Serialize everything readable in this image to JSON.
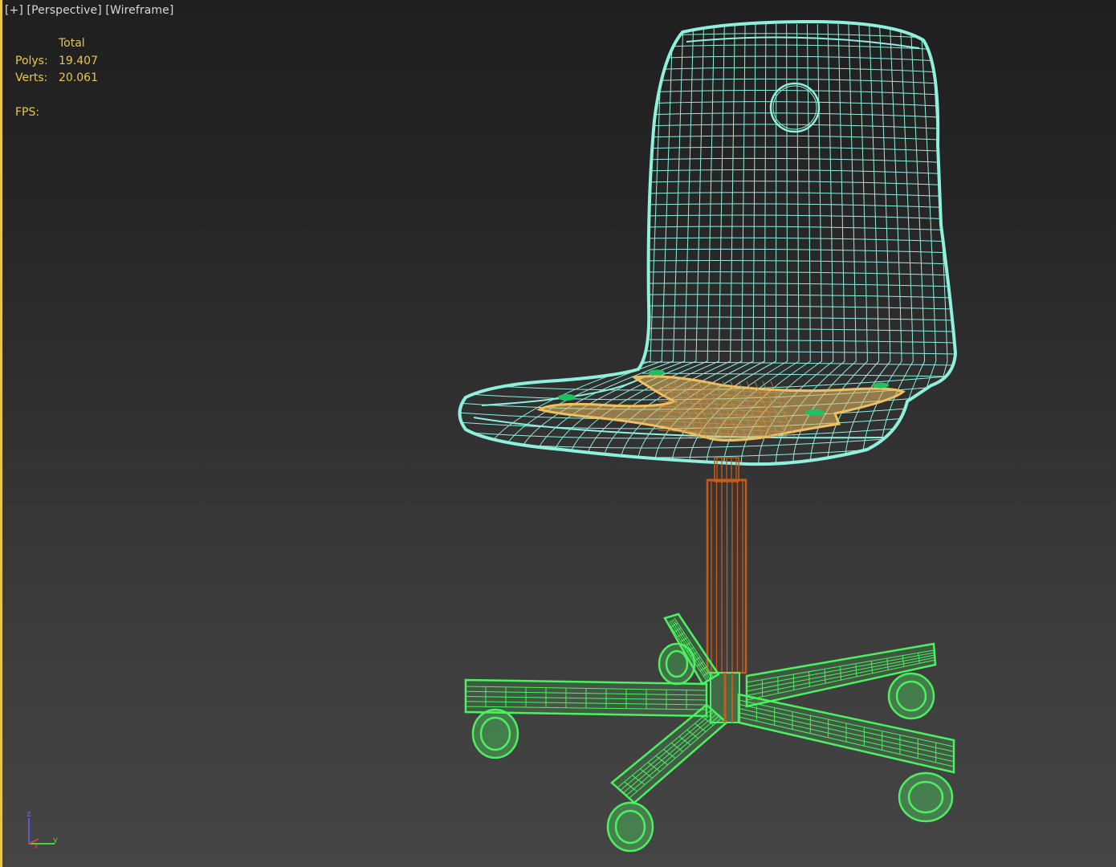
{
  "viewport": {
    "labels": {
      "menu": "[+]",
      "view": "[Perspective]",
      "shading": "[Wireframe]"
    },
    "stats": {
      "header": "Total",
      "polys_label": "Polys:",
      "polys_value": "19.407",
      "verts_label": "Verts:",
      "verts_value": "20.061",
      "fps_label": "FPS:"
    },
    "axis": {
      "z": "z",
      "x": "x",
      "y": "y"
    },
    "colors": {
      "shell": "#8ff0dc",
      "plate": "#f0c060",
      "column": "#c85a1a",
      "base": "#4cf060",
      "stats": "#e8c84a"
    },
    "objects": [
      {
        "name": "seat-shell-wireframe"
      },
      {
        "name": "seat-plate-wireframe"
      },
      {
        "name": "gas-column-wireframe"
      },
      {
        "name": "star-base-wireframe"
      }
    ]
  }
}
